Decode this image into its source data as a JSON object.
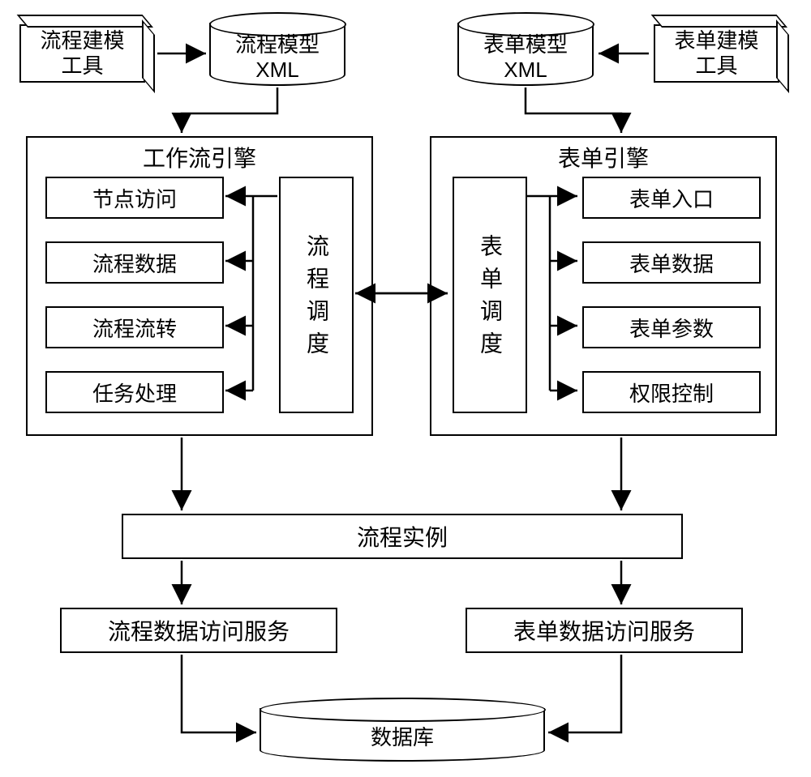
{
  "top": {
    "process_tool": "流程建模\n工具",
    "process_xml": "流程模型\nXML",
    "form_xml": "表单模型\nXML",
    "form_tool": "表单建模\n工具"
  },
  "workflow_engine": {
    "title": "工作流引擎",
    "items": [
      "节点访问",
      "流程数据",
      "流程流转",
      "任务处理"
    ],
    "scheduler": "流程调度"
  },
  "form_engine": {
    "title": "表单引擎",
    "items": [
      "表单入口",
      "表单数据",
      "表单参数",
      "权限控制"
    ],
    "scheduler": "表单调度"
  },
  "middle": {
    "instance": "流程实例"
  },
  "services": {
    "process": "流程数据访问服务",
    "form": "表单数据访问服务"
  },
  "database": "数据库"
}
